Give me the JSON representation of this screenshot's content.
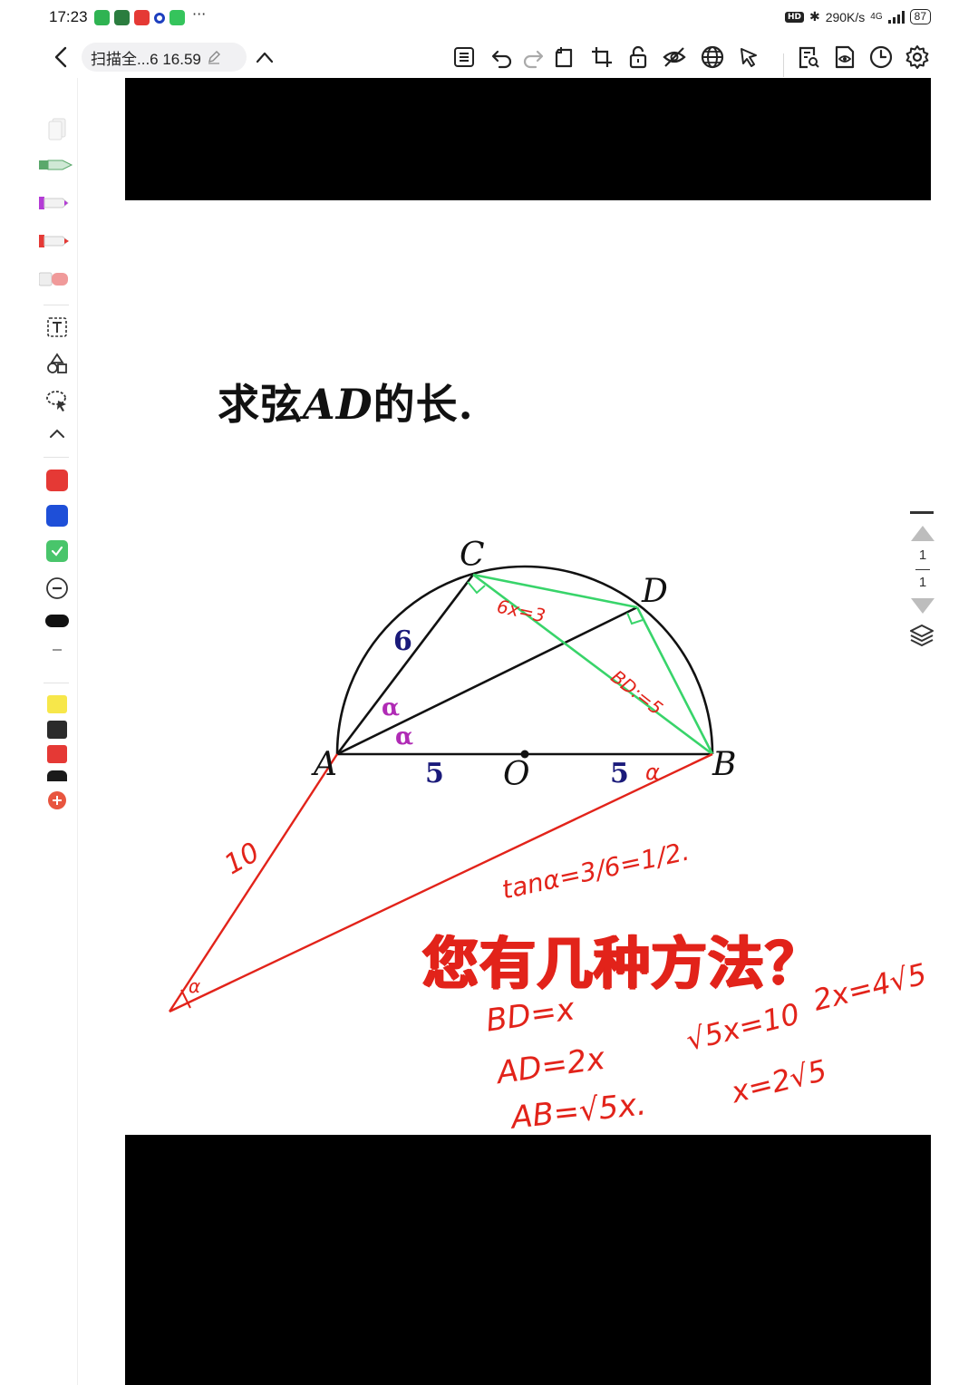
{
  "status_bar": {
    "time": "17:23",
    "hd_badge": "HD",
    "net_speed": "290K/s",
    "network": "4G",
    "battery": "87",
    "more": "···"
  },
  "toolbar": {
    "document_title": "扫描全...6 16.59",
    "icons": [
      "outline-icon",
      "undo-icon",
      "redo-icon",
      "copy-page-icon",
      "crop-icon",
      "lock-icon",
      "hide-icon",
      "globe-icon",
      "pointer-icon",
      "search-doc-icon",
      "preview-icon",
      "history-icon",
      "settings-icon"
    ]
  },
  "palette": {
    "colors": [
      "#e53935",
      "#1e4fd8",
      "#49c56b"
    ],
    "highlight_colors": [
      "#f7e74a",
      "#2b2b2b",
      "#e53935",
      "#1a1a1a"
    ]
  },
  "page": {
    "question_prefix": "求弦",
    "question_var": "AD",
    "question_suffix": "的长.",
    "headline": "您有几种方法？",
    "labels": {
      "A": "A",
      "B": "B",
      "C": "C",
      "D": "D",
      "O": "O",
      "ac_len": "6",
      "ao_len": "5",
      "ob_len": "5",
      "alpha1": "α",
      "alpha2": "α"
    },
    "handwriting": {
      "cd": "6x=3",
      "bc": "BD:=5",
      "angle_b": "α",
      "ae_len": "10",
      "angle_e": "α",
      "tan": "tanα=3/6=1/2.",
      "bd": "BD=x",
      "ad": "AD=2x",
      "ab": "AB=√5x.",
      "eq1": "√5x=10",
      "eq2": "2x=4√5",
      "eq3": "x=2√5"
    }
  },
  "pager": {
    "current": "1",
    "total": "1"
  }
}
